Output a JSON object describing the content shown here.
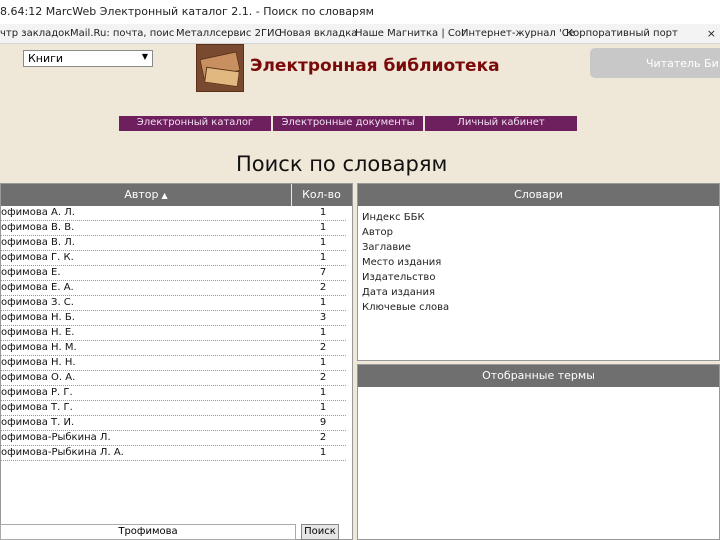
{
  "browser": {
    "title": "8.64:12 MarcWeb Электронный каталог 2.1. - Поиск по словарям",
    "bookmarks": [
      "чтр закладок",
      "Mail.Ru: почта, поис",
      "Металлсервис 2ГИС",
      "Новая вкладка",
      "Наше Магнитка | Сог",
      "Интернет-журнал 'Се",
      "Корпоративный порт"
    ],
    "close": "×"
  },
  "header": {
    "select_value": "Книги",
    "select_arrow": "▼",
    "site_title": "Электронная библиотека",
    "reader_button": "Читатель Би"
  },
  "nav": {
    "items": [
      "Электронный каталог",
      "Электронные документы",
      "Личный кабинет"
    ]
  },
  "page_title": "Поиск по словарям",
  "results": {
    "columns": {
      "author": "Автор",
      "count": "Кол-во"
    },
    "sort_icon": "▲",
    "rows": [
      {
        "author": "офимова А. Л.",
        "count": "1"
      },
      {
        "author": "офимова В. В.",
        "count": "1"
      },
      {
        "author": "офимова В. Л.",
        "count": "1"
      },
      {
        "author": "офимова Г. К.",
        "count": "1"
      },
      {
        "author": "офимова Е.",
        "count": "7"
      },
      {
        "author": "офимова Е. А.",
        "count": "2"
      },
      {
        "author": "офимова З. С.",
        "count": "1"
      },
      {
        "author": "офимова Н. Б.",
        "count": "3"
      },
      {
        "author": "офимова Н. Е.",
        "count": "1"
      },
      {
        "author": "офимова Н. М.",
        "count": "2"
      },
      {
        "author": "офимова Н. Н.",
        "count": "1"
      },
      {
        "author": "офимова О. А.",
        "count": "2"
      },
      {
        "author": "офимова Р. Г.",
        "count": "1"
      },
      {
        "author": "офимова Т. Г.",
        "count": "1"
      },
      {
        "author": "офимова Т. И.",
        "count": "9"
      },
      {
        "author": "офимова-Рыбкина Л.",
        "count": "2"
      },
      {
        "author": "офимова-Рыбкина Л. А.",
        "count": "1"
      }
    ]
  },
  "search": {
    "value": "Трофимова",
    "button": "Поиск"
  },
  "dictionaries": {
    "heading": "Словари",
    "items": [
      "Индекс ББК",
      "Автор",
      "Заглавие",
      "Место издания",
      "Издательство",
      "Дата издания",
      "Ключевые слова"
    ]
  },
  "selected_terms": {
    "heading": "Отобранные термы"
  }
}
